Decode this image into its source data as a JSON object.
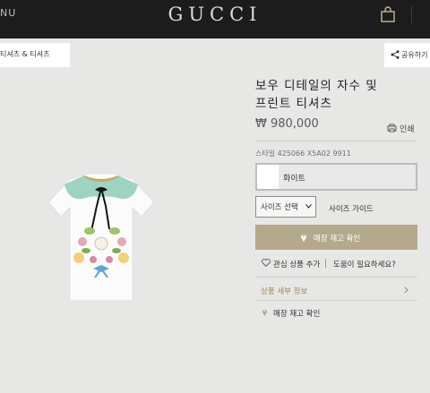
{
  "header": {
    "menu_label": "NU",
    "logo": "GUCCI",
    "icons": [
      "shopping-bag-icon"
    ]
  },
  "breadcrumb": "티셔츠 & 티셔츠",
  "share": {
    "label": "공유하기",
    "icon": "share-icon"
  },
  "product": {
    "title_line1": "보우 디테일의 자수 및",
    "title_line2": "프린트 티셔츠",
    "price": "₩ 980,000",
    "print_label": "인쇄",
    "style_number": "스타일 425066 X5A02 9911",
    "color": {
      "label": "화이트",
      "swatch": "#ffffff"
    },
    "size_select": "사이즈 선택",
    "size_guide": "사이즈 가이드",
    "store_button": "매장 재고 확인",
    "wishlist": "관심 상품 추가",
    "help": "도움이 필요하세요?",
    "details_link": "상품 세부 정보",
    "stock_link": "매장 재고 확인"
  },
  "colors": {
    "topbar": "#1c1c1c",
    "background": "#e7e7e5",
    "accent_gold": "#b5a98c",
    "details_link": "#9a8a5a"
  }
}
